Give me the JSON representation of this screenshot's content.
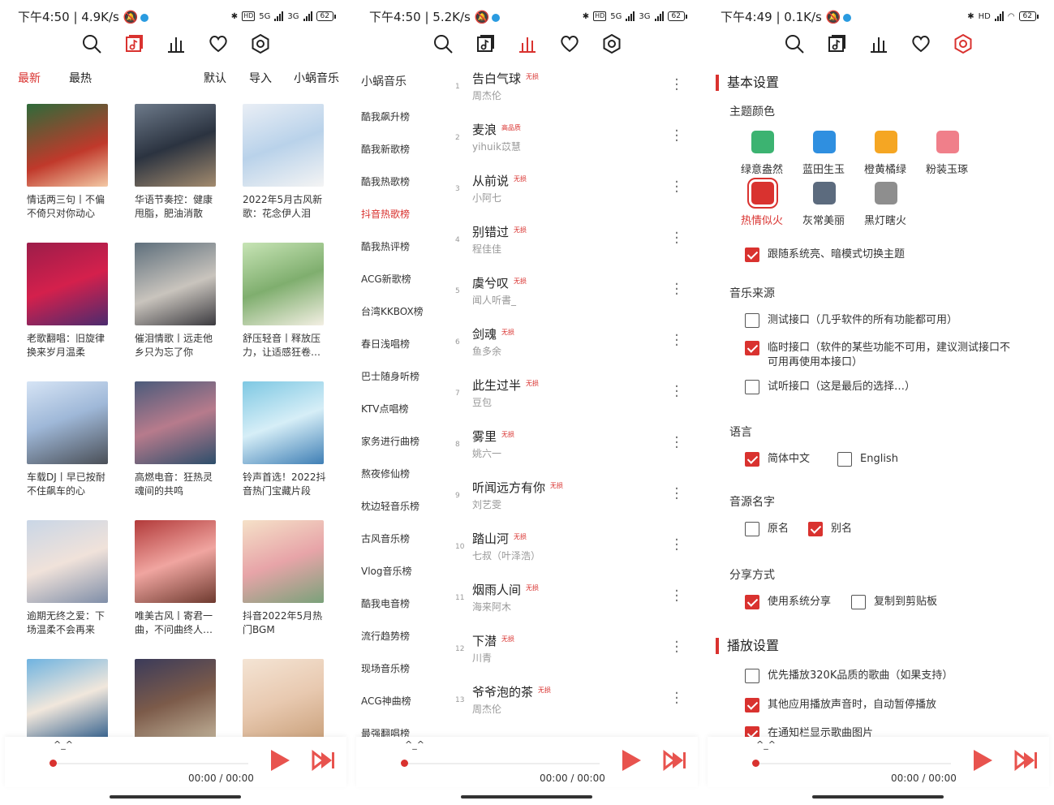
{
  "colors": {
    "accent": "#d9322f"
  },
  "panels": [
    {
      "status": {
        "time": "下午4:50",
        "speed": "4.9K/s",
        "battery": "62",
        "net1": "5G",
        "net2": "3G"
      }
    },
    {
      "status": {
        "time": "下午4:50",
        "speed": "5.2K/s",
        "battery": "62",
        "net1": "5G",
        "net2": "3G"
      }
    },
    {
      "status": {
        "time": "下午4:49",
        "speed": "0.1K/s",
        "battery": "62",
        "net1": "HD",
        "net2": ""
      }
    }
  ],
  "nav_icons": [
    "search-icon",
    "song-list-icon",
    "chart-icon",
    "heart-icon",
    "settings-icon"
  ],
  "songlist": {
    "tab_latest": "最新",
    "tab_hot": "最热",
    "sort_default": "默认",
    "import": "导入",
    "source": "小蜗音乐",
    "cards": [
      "情话两三句丨不偏不倚只对你动心",
      "华语节奏控：健康甩脂，肥油消散",
      "2022年5月古风新歌：花念伊人泪",
      "老歌翻唱：旧旋律换来岁月温柔",
      "催泪情歌丨远走他乡只为忘了你",
      "舒压轻音丨释放压力，让适感狂卷…",
      "车载DJ丨早已按耐不住飙车的心",
      "高燃电音：狂热灵魂间的共鸣",
      "铃声首选！2022抖音热门宝藏片段",
      "逾期无终之爱：下场温柔不会再来",
      "唯美古风丨寄君一曲，不问曲终人…",
      "抖音2022年5月热门BGM",
      "",
      "",
      ""
    ]
  },
  "leaderboard": {
    "sources": [
      "小蜗音乐",
      "酷我飙升榜",
      "酷我新歌榜",
      "酷我热歌榜",
      "抖音热歌榜",
      "酷我热评榜",
      "ACG新歌榜",
      "台湾KKBOX榜",
      "春日浅唱榜",
      "巴士随身听榜",
      "KTV点唱榜",
      "家务进行曲榜",
      "熬夜修仙榜",
      "枕边轻音乐榜",
      "古风音乐榜",
      "Vlog音乐榜",
      "酷我电音榜",
      "流行趋势榜",
      "现场音乐榜",
      "ACG神曲榜",
      "最强翻唱榜"
    ],
    "active_index": 4,
    "songs": [
      {
        "idx": "1",
        "name": "告白气球",
        "quality": "无损",
        "artist": "周杰伦"
      },
      {
        "idx": "2",
        "name": "麦浪",
        "quality": "高品质",
        "artist": "yihuik苡慧"
      },
      {
        "idx": "3",
        "name": "从前说",
        "quality": "无损",
        "artist": "小阿七"
      },
      {
        "idx": "4",
        "name": "别错过",
        "quality": "无损",
        "artist": "程佳佳"
      },
      {
        "idx": "5",
        "name": "虞兮叹",
        "quality": "无损",
        "artist": "闻人听書_"
      },
      {
        "idx": "6",
        "name": "剑魂",
        "quality": "无损",
        "artist": "鱼多余"
      },
      {
        "idx": "7",
        "name": "此生过半",
        "quality": "无损",
        "artist": "豆包"
      },
      {
        "idx": "8",
        "name": "雾里",
        "quality": "无损",
        "artist": "姚六一"
      },
      {
        "idx": "9",
        "name": "听闻远方有你",
        "quality": "无损",
        "artist": "刘艺雯"
      },
      {
        "idx": "10",
        "name": "踏山河",
        "quality": "无损",
        "artist": "七叔（叶泽浩）"
      },
      {
        "idx": "11",
        "name": "烟雨人间",
        "quality": "无损",
        "artist": "海来阿木"
      },
      {
        "idx": "12",
        "name": "下潜",
        "quality": "无损",
        "artist": "川青"
      },
      {
        "idx": "13",
        "name": "爷爷泡的茶",
        "quality": "无损",
        "artist": "周杰伦"
      }
    ]
  },
  "settings": {
    "basic": "基本设置",
    "theme_color": "主题颜色",
    "themes": [
      {
        "label": "绿意盎然",
        "color": "#3cb371",
        "selected": false
      },
      {
        "label": "蓝田生玉",
        "color": "#2f8fe0",
        "selected": false
      },
      {
        "label": "橙黄橘绿",
        "color": "#f5a623",
        "selected": false
      },
      {
        "label": "粉装玉琢",
        "color": "#f07f8a",
        "selected": false
      },
      {
        "label": "热情似火",
        "color": "#d9322f",
        "selected": true
      },
      {
        "label": "灰常美丽",
        "color": "#5c6b7e",
        "selected": false
      },
      {
        "label": "黑灯瞎火",
        "color": "#8e8e8e",
        "selected": false
      }
    ],
    "follow_system": "跟随系统亮、暗模式切换主题",
    "music_source": "音乐来源",
    "source_test": "测试接口（几乎软件的所有功能都可用）",
    "source_temp": "临时接口（软件的某些功能不可用，建议测试接口不可用再使用本接口）",
    "source_trial": "试听接口（这是最后的选择…）",
    "language": "语言",
    "lang_zh": "简体中文",
    "lang_en": "English",
    "source_name": "音源名字",
    "name_original": "原名",
    "name_alias": "别名",
    "share": "分享方式",
    "share_system": "使用系统分享",
    "share_clipboard": "复制到剪贴板",
    "playback": "播放设置",
    "play_320k": "优先播放320K品质的歌曲（如果支持）",
    "auto_pause": "其他应用播放声音时，自动暂停播放",
    "show_cover": "在通知栏显示歌曲图片"
  },
  "player": {
    "title": "^_^",
    "time": "00:00 / 00:00"
  }
}
